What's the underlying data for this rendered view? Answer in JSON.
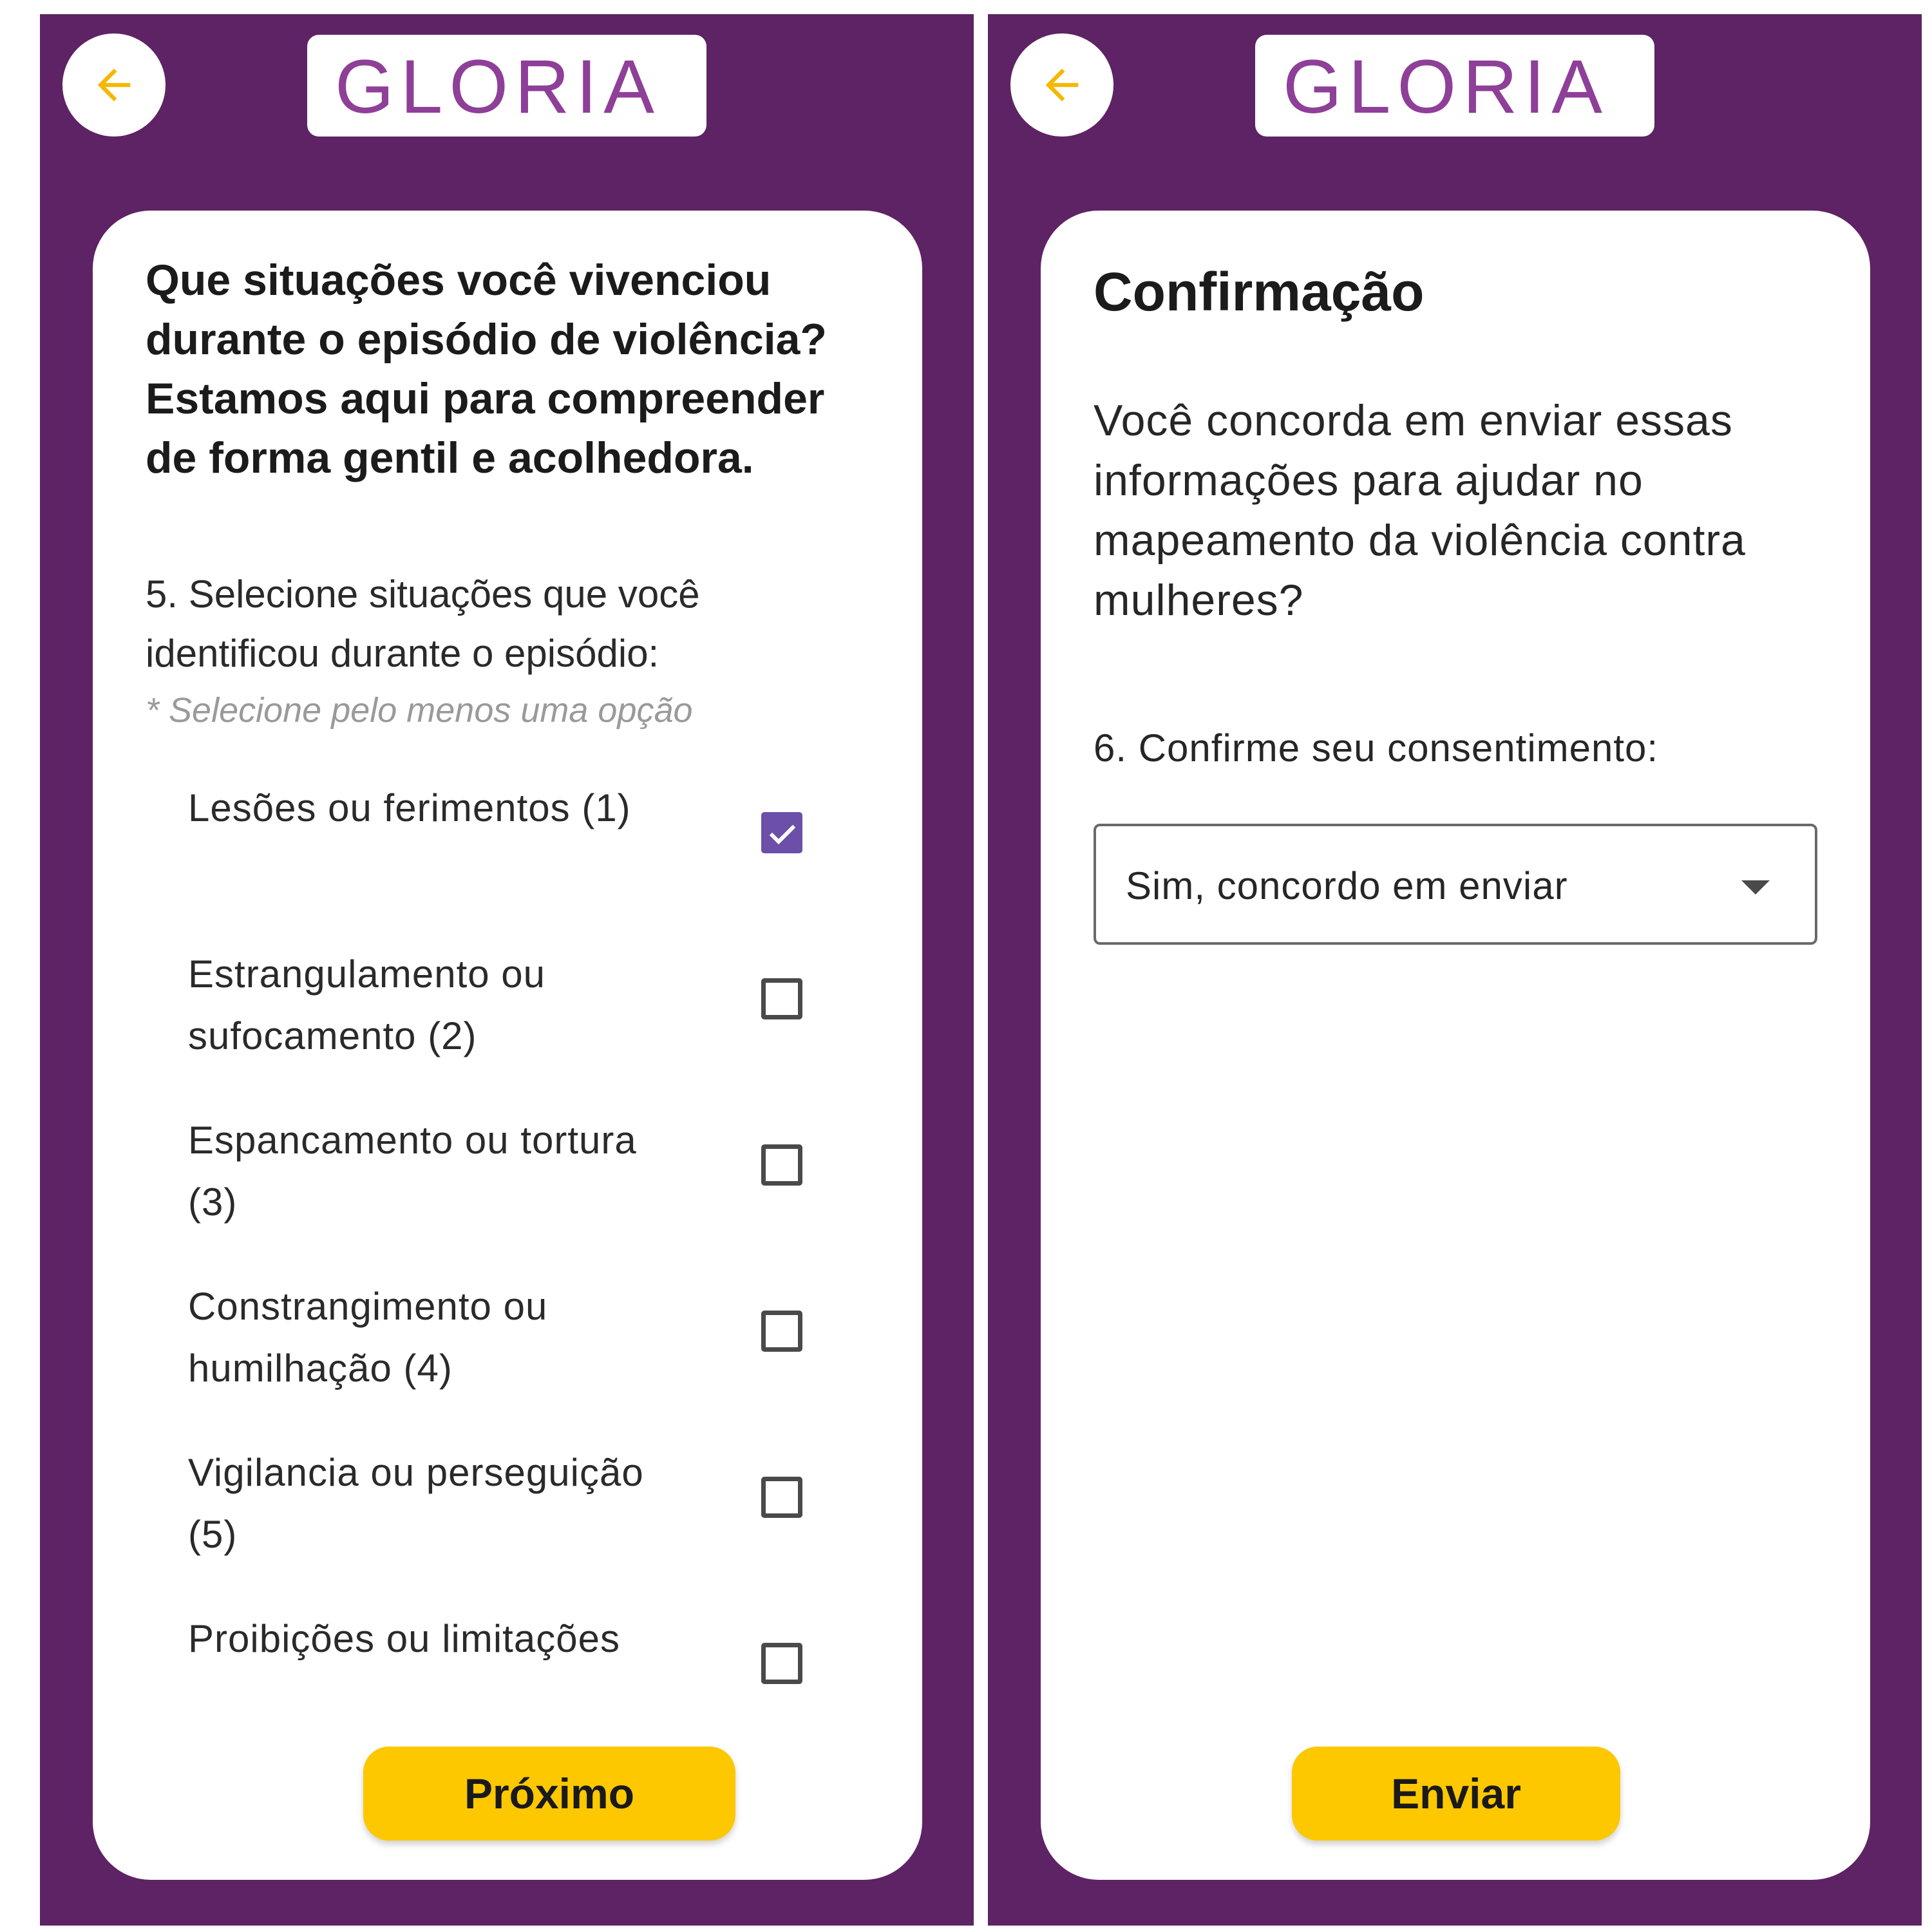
{
  "app": {
    "logo_text": "GLORIA"
  },
  "colors": {
    "brand_purple": "#5e2364",
    "accent_yellow": "#fdc800",
    "logo_purple": "#8e3f98",
    "checkbox_purple": "#6b4fa8"
  },
  "left_screen": {
    "back_icon": "arrow-left-icon",
    "heading": "Que situações você vivenciou durante o episódio de violência? Estamos aqui para compreender de forma gentil e acolhedora.",
    "question_label": "5. Selecione situações que você identificou durante o episódio:",
    "hint": "* Selecione pelo menos uma opção",
    "options": [
      {
        "label": "Lesões ou ferimentos (1)",
        "checked": true
      },
      {
        "label": "Estrangulamento ou sufocamento (2)",
        "checked": false
      },
      {
        "label": "Espancamento ou tortura (3)",
        "checked": false
      },
      {
        "label": "Constrangimento ou humilhação (4)",
        "checked": false
      },
      {
        "label": "Vigilancia ou perseguição (5)",
        "checked": false
      },
      {
        "label": "Proibições ou limitações",
        "checked": false
      }
    ],
    "next_button": "Próximo"
  },
  "right_screen": {
    "back_icon": "arrow-left-icon",
    "title": "Confirmação",
    "question": "Você concorda em enviar essas informações para ajudar no mapeamento da violência contra mulheres?",
    "consent_label": "6. Confirme seu consentimento:",
    "consent_selected": "Sim, concordo em enviar",
    "send_button": "Enviar"
  }
}
